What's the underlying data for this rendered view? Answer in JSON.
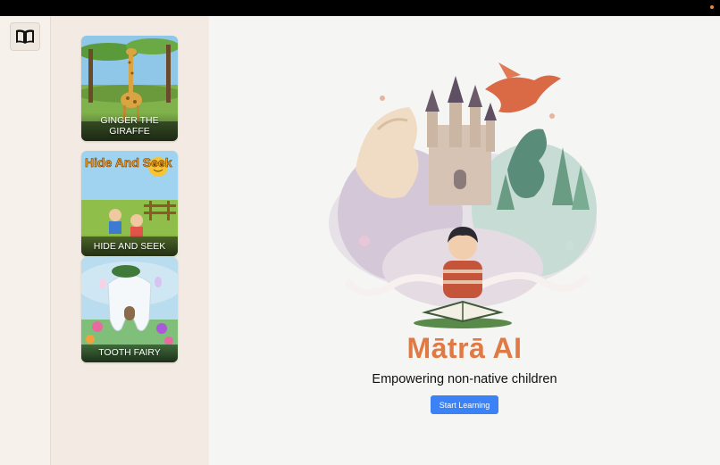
{
  "window": {
    "status_dot_color": "#e8893b"
  },
  "sidebar": {
    "library_icon": "open-book-icon"
  },
  "stories": [
    {
      "title": "GINGER THE GIRAFFE"
    },
    {
      "title": "HIDE AND SEEK",
      "cover_text": "Hide And Seek"
    },
    {
      "title": "TOOTH FAIRY"
    }
  ],
  "main": {
    "brand": "Mātrā AI",
    "brand_color": "#e07a45",
    "tagline": "Empowering non-native children",
    "cta_label": "Start Learning",
    "cta_color": "#3b82f6"
  }
}
